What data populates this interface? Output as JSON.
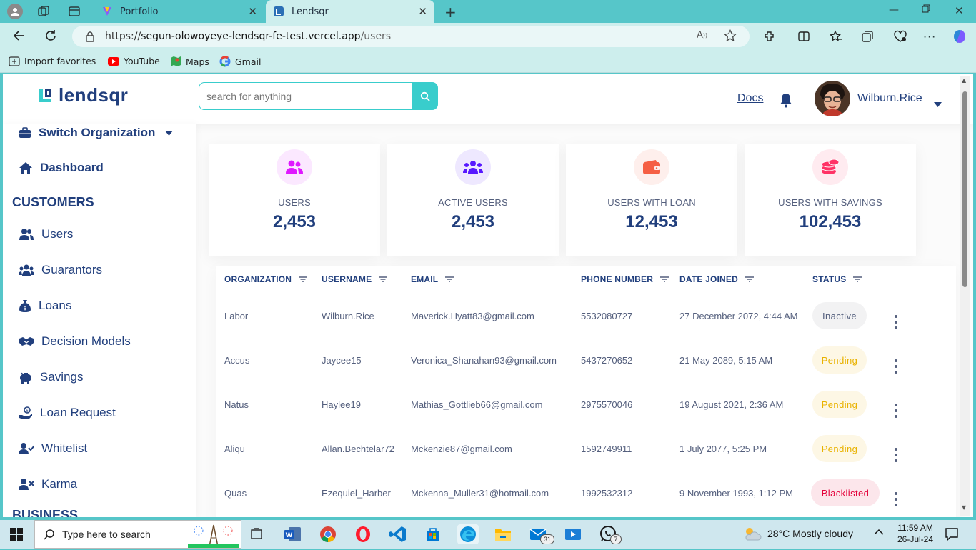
{
  "browser": {
    "tabs": [
      {
        "title": "Portfolio"
      },
      {
        "title": "Lendsqr"
      }
    ],
    "url_prefix": "https://",
    "url_host": "segun-olowoyeye-lendsqr-fe-test.vercel.app",
    "url_path": "/users",
    "favorites": [
      {
        "label": "Import favorites"
      },
      {
        "label": "YouTube"
      },
      {
        "label": "Maps"
      },
      {
        "label": "Gmail"
      }
    ]
  },
  "header": {
    "logo_text": "lendsqr",
    "search_placeholder": "search for anything",
    "docs_label": "Docs",
    "user_name": "Wilburn.Rice"
  },
  "sidebar": {
    "switch_org": "Switch Organization",
    "dashboard": "Dashboard",
    "section_customers": "CUSTOMERS",
    "items": [
      {
        "label": "Users",
        "icon": "users-icon"
      },
      {
        "label": "Guarantors",
        "icon": "guarantors-icon"
      },
      {
        "label": "Loans",
        "icon": "money-sack-icon"
      },
      {
        "label": "Decision Models",
        "icon": "handshake-icon"
      },
      {
        "label": "Savings",
        "icon": "piggy-bank-icon"
      },
      {
        "label": "Loan Request",
        "icon": "loan-request-icon"
      },
      {
        "label": "Whitelist",
        "icon": "user-check-icon"
      },
      {
        "label": "Karma",
        "icon": "user-x-icon"
      }
    ],
    "section_business": "BUSINESS"
  },
  "stats": [
    {
      "label": "USERS",
      "value": "2,453",
      "color": "#df18ff"
    },
    {
      "label": "ACTIVE USERS",
      "value": "2,453",
      "color": "#5718ff"
    },
    {
      "label": "USERS WITH LOAN",
      "value": "12,453",
      "color": "#f55f44"
    },
    {
      "label": "USERS WITH SAVINGS",
      "value": "102,453",
      "color": "#ff3366"
    }
  ],
  "table": {
    "headers": [
      "ORGANIZATION",
      "USERNAME",
      "EMAIL",
      "PHONE NUMBER",
      "DATE JOINED",
      "STATUS"
    ],
    "rows": [
      {
        "org": "Labor",
        "username": "Wilburn.Rice",
        "email": "Maverick.Hyatt83@gmail.com",
        "phone": "5532080727",
        "date": "27 December 2072, 4:44 AM",
        "status": "Inactive"
      },
      {
        "org": "Accus",
        "username": "Jaycee15",
        "email": "Veronica_Shanahan93@gmail.com",
        "phone": "5437270652",
        "date": "21 May 2089, 5:15 AM",
        "status": "Pending"
      },
      {
        "org": "Natus",
        "username": "Haylee19",
        "email": "Mathias_Gottlieb66@gmail.com",
        "phone": "2975570046",
        "date": "19 August 2021, 2:36 AM",
        "status": "Pending"
      },
      {
        "org": "Aliqu",
        "username": "Allan.Bechtelar72",
        "email": "Mckenzie87@gmail.com",
        "phone": "1592749911",
        "date": "1 July 2077, 5:25 PM",
        "status": "Pending"
      },
      {
        "org": "Quas-",
        "username": "Ezequiel_Harber",
        "email": "Mckenna_Muller31@hotmail.com",
        "phone": "1992532312",
        "date": "9 November 1993, 1:12 PM",
        "status": "Blacklisted"
      }
    ],
    "status_colors": {
      "Inactive": {
        "bg": "#f2f2f3",
        "fg": "#545f7d"
      },
      "Pending": {
        "bg": "#fdf7e5",
        "fg": "#e9b200"
      },
      "Blacklisted": {
        "bg": "#fce6eb",
        "fg": "#e4033b"
      }
    }
  },
  "taskbar": {
    "search_placeholder": "Type here to search",
    "weather": "28°C  Mostly cloudy",
    "time": "11:59 AM",
    "date": "26-Jul-24",
    "mail_badge": "31",
    "whatsapp_badge": "7"
  },
  "accent": "#39cdcc",
  "brand": "#213f7d"
}
